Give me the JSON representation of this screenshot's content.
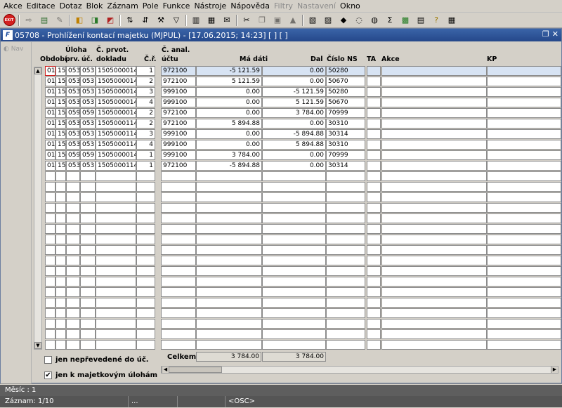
{
  "menu": [
    "Akce",
    "Editace",
    "Dotaz",
    "Blok",
    "Záznam",
    "Pole",
    "Funkce",
    "Nástroje",
    "Nápověda",
    "Filtry",
    "Nastavení",
    "Okno"
  ],
  "menu_disabled": [
    "Filtry",
    "Nastavení"
  ],
  "toolbar_icons": [
    "exit-icon",
    "save-icon",
    "print-icon",
    "delete-icon",
    "enter-query-icon",
    "execute-query-icon",
    "cancel-query-icon",
    "sort-asc-icon",
    "sort-desc-icon",
    "tool-icon",
    "filter-icon",
    "print-preview-icon",
    "clipboard-icon",
    "mail-icon",
    "cut-icon",
    "copy-icon",
    "paste-icon",
    "clear-icon",
    "calculator-icon",
    "dictionary-icon",
    "export-icon",
    "help-icon",
    "sum-icon",
    "excel-icon",
    "calendar-icon",
    "question-icon",
    "info-icon"
  ],
  "window": {
    "title": "05708 - Prohlížení kontací majetku (MJPUL) - [17.06.2015; 14:23] [ ] [ ]",
    "app_icon": "F",
    "restore": "❐",
    "close": "✕"
  },
  "nav": {
    "label": "Nav"
  },
  "columns": {
    "obdobi": "Období",
    "uloha": "Úloha",
    "prv": "prv.",
    "uc": "úč.",
    "c_prvot": "Č. prvot.",
    "doklad": "dokladu",
    "cr": "Č.ř.",
    "c_anal": "Č. anal.",
    "uctu": "účtu",
    "ma_dati": "Má dáti",
    "dal": "Dal",
    "cislo_ns": "Číslo NS",
    "ta": "TA",
    "akce": "Akce",
    "kp": "KP"
  },
  "rows": [
    {
      "obdobi": "01",
      "uloha": "15",
      "prv": "053",
      "uc": "053",
      "doklad": "1505000014",
      "cr": "1",
      "ucet": "972100",
      "ma_dati": "-5 121.59",
      "dal": "0.00",
      "ns": "50280"
    },
    {
      "obdobi": "01",
      "uloha": "15",
      "prv": "053",
      "uc": "053",
      "doklad": "1505000014",
      "cr": "2",
      "ucet": "972100",
      "ma_dati": "5 121.59",
      "dal": "0.00",
      "ns": "50670"
    },
    {
      "obdobi": "01",
      "uloha": "15",
      "prv": "053",
      "uc": "053",
      "doklad": "1505000014",
      "cr": "3",
      "ucet": "999100",
      "ma_dati": "0.00",
      "dal": "-5 121.59",
      "ns": "50280"
    },
    {
      "obdobi": "01",
      "uloha": "15",
      "prv": "053",
      "uc": "053",
      "doklad": "1505000014",
      "cr": "4",
      "ucet": "999100",
      "ma_dati": "0.00",
      "dal": "5 121.59",
      "ns": "50670"
    },
    {
      "obdobi": "01",
      "uloha": "15",
      "prv": "059",
      "uc": "059",
      "doklad": "1505000014",
      "cr": "2",
      "ucet": "972100",
      "ma_dati": "0.00",
      "dal": "3 784.00",
      "ns": "70999"
    },
    {
      "obdobi": "01",
      "uloha": "15",
      "prv": "053",
      "uc": "053",
      "doklad": "1505000114",
      "cr": "2",
      "ucet": "972100",
      "ma_dati": "5 894.88",
      "dal": "0.00",
      "ns": "30310"
    },
    {
      "obdobi": "01",
      "uloha": "15",
      "prv": "053",
      "uc": "053",
      "doklad": "1505000114",
      "cr": "3",
      "ucet": "999100",
      "ma_dati": "0.00",
      "dal": "-5 894.88",
      "ns": "30314"
    },
    {
      "obdobi": "01",
      "uloha": "15",
      "prv": "053",
      "uc": "053",
      "doklad": "1505000114",
      "cr": "4",
      "ucet": "999100",
      "ma_dati": "0.00",
      "dal": "5 894.88",
      "ns": "30310"
    },
    {
      "obdobi": "01",
      "uloha": "15",
      "prv": "059",
      "uc": "059",
      "doklad": "1505000014",
      "cr": "1",
      "ucet": "999100",
      "ma_dati": "3 784.00",
      "dal": "0.00",
      "ns": "70999"
    },
    {
      "obdobi": "01",
      "uloha": "15",
      "prv": "053",
      "uc": "053",
      "doklad": "1505000114",
      "cr": "1",
      "ucet": "972100",
      "ma_dati": "-5 894.88",
      "dal": "0.00",
      "ns": "30314"
    }
  ],
  "total_rows": 27,
  "checkboxes": [
    {
      "label": "jen nepřevedené do úč.",
      "checked": false
    },
    {
      "label": "jen k majetkovým úlohám",
      "checked": true
    }
  ],
  "checkmark": "✔",
  "summary": {
    "label": "Celkem",
    "ma_dati": "3 784.00",
    "dal": "3 784.00"
  },
  "status": {
    "line1": "Měsíc : 1",
    "record": "Záznam: 1/10",
    "seg2": "...",
    "seg3": "",
    "seg4": "<OSC>"
  },
  "colors": {
    "title_bar": "#25488a",
    "selected_row": "#d7e3f3",
    "current_cell_border": "#d02020"
  }
}
